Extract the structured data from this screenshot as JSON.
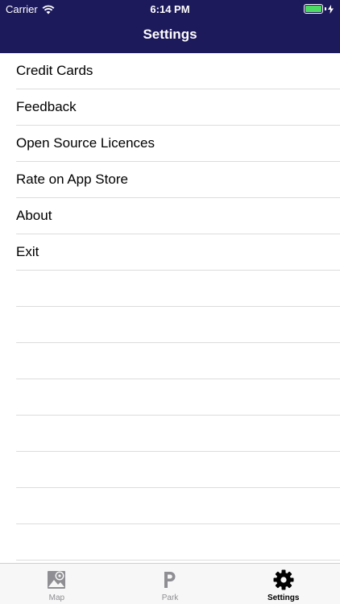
{
  "status_bar": {
    "carrier": "Carrier",
    "time": "6:14 PM",
    "battery_color": "#4cd964"
  },
  "nav": {
    "title": "Settings",
    "background": "#1d1a5c"
  },
  "menu": {
    "items": [
      {
        "label": "Credit Cards"
      },
      {
        "label": "Feedback"
      },
      {
        "label": "Open Source Licences"
      },
      {
        "label": "Rate on App Store"
      },
      {
        "label": "About"
      },
      {
        "label": "Exit"
      }
    ]
  },
  "tabbar": {
    "tabs": [
      {
        "label": "Map",
        "icon": "map-pin-icon",
        "selected": false
      },
      {
        "label": "Park",
        "icon": "parking-p-icon",
        "selected": false
      },
      {
        "label": "Settings",
        "icon": "gear-icon",
        "selected": true
      }
    ]
  }
}
